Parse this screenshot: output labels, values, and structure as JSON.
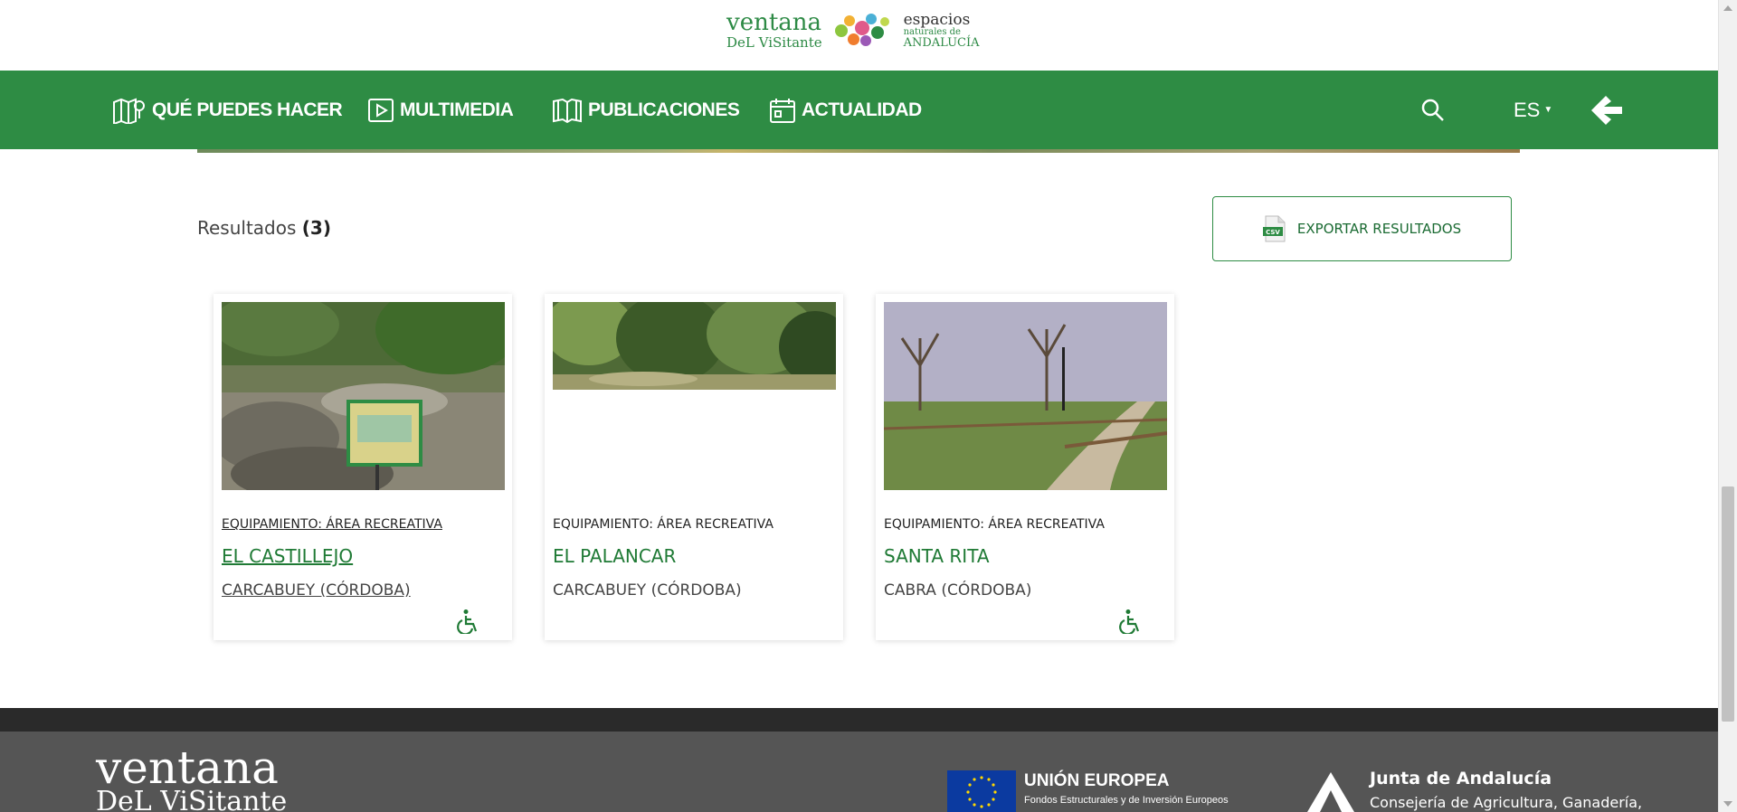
{
  "header": {
    "logo_line1": "ventana",
    "logo_line2": "DeL ViSitante",
    "logo2_line1": "espacios",
    "logo2_line2": "naturales de",
    "logo2_line3": "ANDALUCÍA"
  },
  "nav": {
    "items": [
      {
        "label": "QUÉ PUEDES HACER",
        "icon": "map-pin-icon"
      },
      {
        "label": "MULTIMEDIA",
        "icon": "play-icon"
      },
      {
        "label": "PUBLICACIONES",
        "icon": "book-icon"
      },
      {
        "label": "ACTUALIDAD",
        "icon": "calendar-icon"
      }
    ],
    "search_icon": "search-icon",
    "language": "ES",
    "back_icon": "arrow-left-icon"
  },
  "results": {
    "label": "Resultados",
    "count": "(3)",
    "export_label": "EXPORTAR RESULTADOS",
    "export_icon": "csv-file-icon",
    "export_icon_text": "CSV"
  },
  "cards": [
    {
      "type": "EQUIPAMIENTO: ÁREA RECREATIVA",
      "title": "EL CASTILLEJO",
      "location": "CARCABUEY (CÓRDOBA)",
      "accessible": true
    },
    {
      "type": "EQUIPAMIENTO: ÁREA RECREATIVA",
      "title": "EL PALANCAR",
      "location": "CARCABUEY (CÓRDOBA)",
      "accessible": false
    },
    {
      "type": "EQUIPAMIENTO: ÁREA RECREATIVA",
      "title": "SANTA RITA",
      "location": "CABRA (CÓRDOBA)",
      "accessible": true
    }
  ],
  "footer": {
    "logo_line1": "ventana",
    "logo_line2": "DeL ViSitante",
    "eu_title": "UNIÓN EUROPEA",
    "eu_subtitle": "Fondos Estructurales y de Inversión Europeos",
    "junta_title": "Junta de Andalucía",
    "junta_subtitle": "Consejería de Agricultura, Ganadería,"
  },
  "colors": {
    "brand_green": "#2e8c44",
    "title_green": "#1f7a35",
    "footer_dark": "#555555"
  }
}
